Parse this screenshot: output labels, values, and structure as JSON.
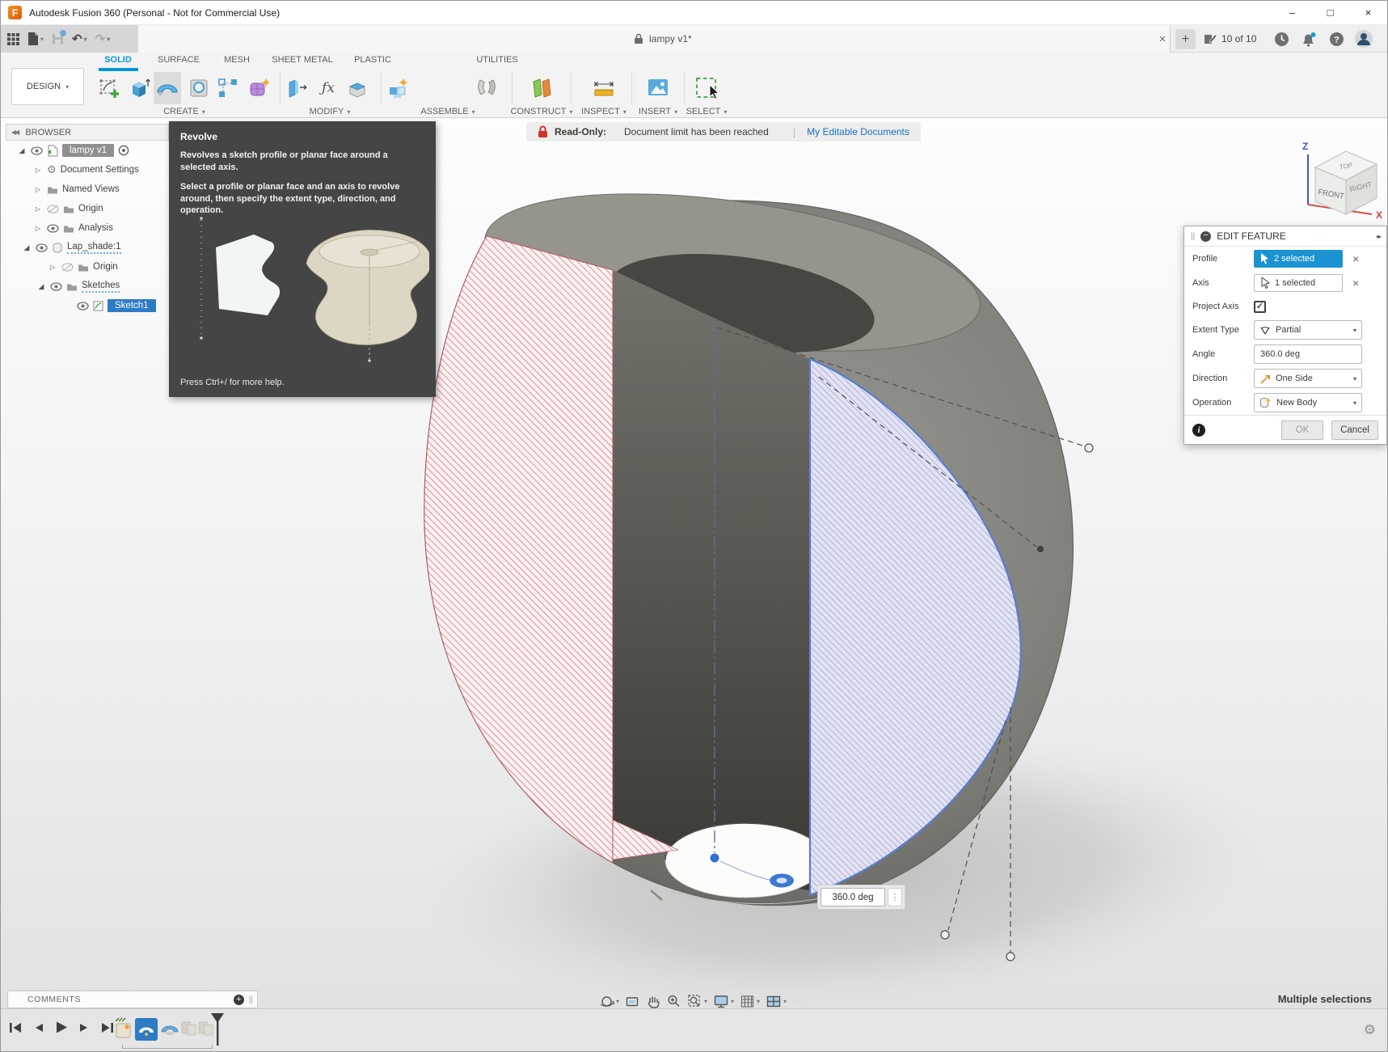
{
  "window": {
    "title": "Autodesk Fusion 360 (Personal - Not for Commercial Use)"
  },
  "glyphs": {
    "logo": "F",
    "caret": "▾",
    "close": "×",
    "plus": "+",
    "minimize": "–",
    "maximize": "□",
    "window_close": "×",
    "grip": "||",
    "double_right": "▸▸",
    "double_left": "◀◀",
    "undo": "↶",
    "redo": "↷",
    "question": "?",
    "fx": "ƒx",
    "info": "i",
    "dots": "⋮",
    "check": "✓",
    "gear": "⚙",
    "tri_collapsed": "▷",
    "tri_expanded": "◢"
  },
  "toolbar": {
    "tab_title": "lampy v1*",
    "extensions_count": "10 of 10"
  },
  "ribbon": {
    "design_label": "DESIGN",
    "tabs": [
      "SOLID",
      "SURFACE",
      "MESH",
      "SHEET METAL",
      "PLASTIC",
      "UTILITIES"
    ],
    "groups": [
      "CREATE",
      "MODIFY",
      "ASSEMBLE",
      "CONSTRUCT",
      "INSPECT",
      "INSERT",
      "SELECT"
    ]
  },
  "browser": {
    "header": "BROWSER",
    "items": [
      {
        "label": "lampy v1"
      },
      {
        "label": "Document Settings"
      },
      {
        "label": "Named Views"
      },
      {
        "label": "Origin"
      },
      {
        "label": "Analysis"
      },
      {
        "label": "Lap_shade:1"
      },
      {
        "label": "Origin"
      },
      {
        "label": "Sketches"
      },
      {
        "label": "Sketch1"
      }
    ]
  },
  "tooltip": {
    "title": "Revolve",
    "p1": "Revolves a sketch profile or planar face around a selected axis.",
    "p2": "Select a profile or planar face and an axis to revolve around, then specify the extent type, direction, and operation.",
    "footer": "Press Ctrl+/ for more help."
  },
  "banner": {
    "label": "Read-Only:",
    "message": "Document limit has been reached",
    "divider": "|",
    "link": "My Editable Documents"
  },
  "viewcube": {
    "top": "TOP",
    "front": "FRONT",
    "right": "RIGHT",
    "axis_x": "X",
    "axis_z": "Z"
  },
  "dialog": {
    "title": "EDIT FEATURE",
    "profile_label": "Profile",
    "profile_value": "2 selected",
    "axis_label": "Axis",
    "axis_value": "1 selected",
    "project_axis_label": "Project Axis",
    "extent_label": "Extent Type",
    "extent_value": "Partial",
    "angle_label": "Angle",
    "angle_value": "360.0 deg",
    "direction_label": "Direction",
    "direction_value": "One Side",
    "operation_label": "Operation",
    "operation_value": "New Body",
    "ok_label": "OK",
    "cancel_label": "Cancel"
  },
  "viewport": {
    "angle_value": "360.0 deg",
    "status": "Multiple selections"
  },
  "comments": {
    "label": "COMMENTS"
  },
  "colors": {
    "accent": "#0696d7",
    "selection_blue": "#2e7bc4",
    "readonly_red": "#ce342c",
    "link_blue": "#1a6fc4"
  }
}
